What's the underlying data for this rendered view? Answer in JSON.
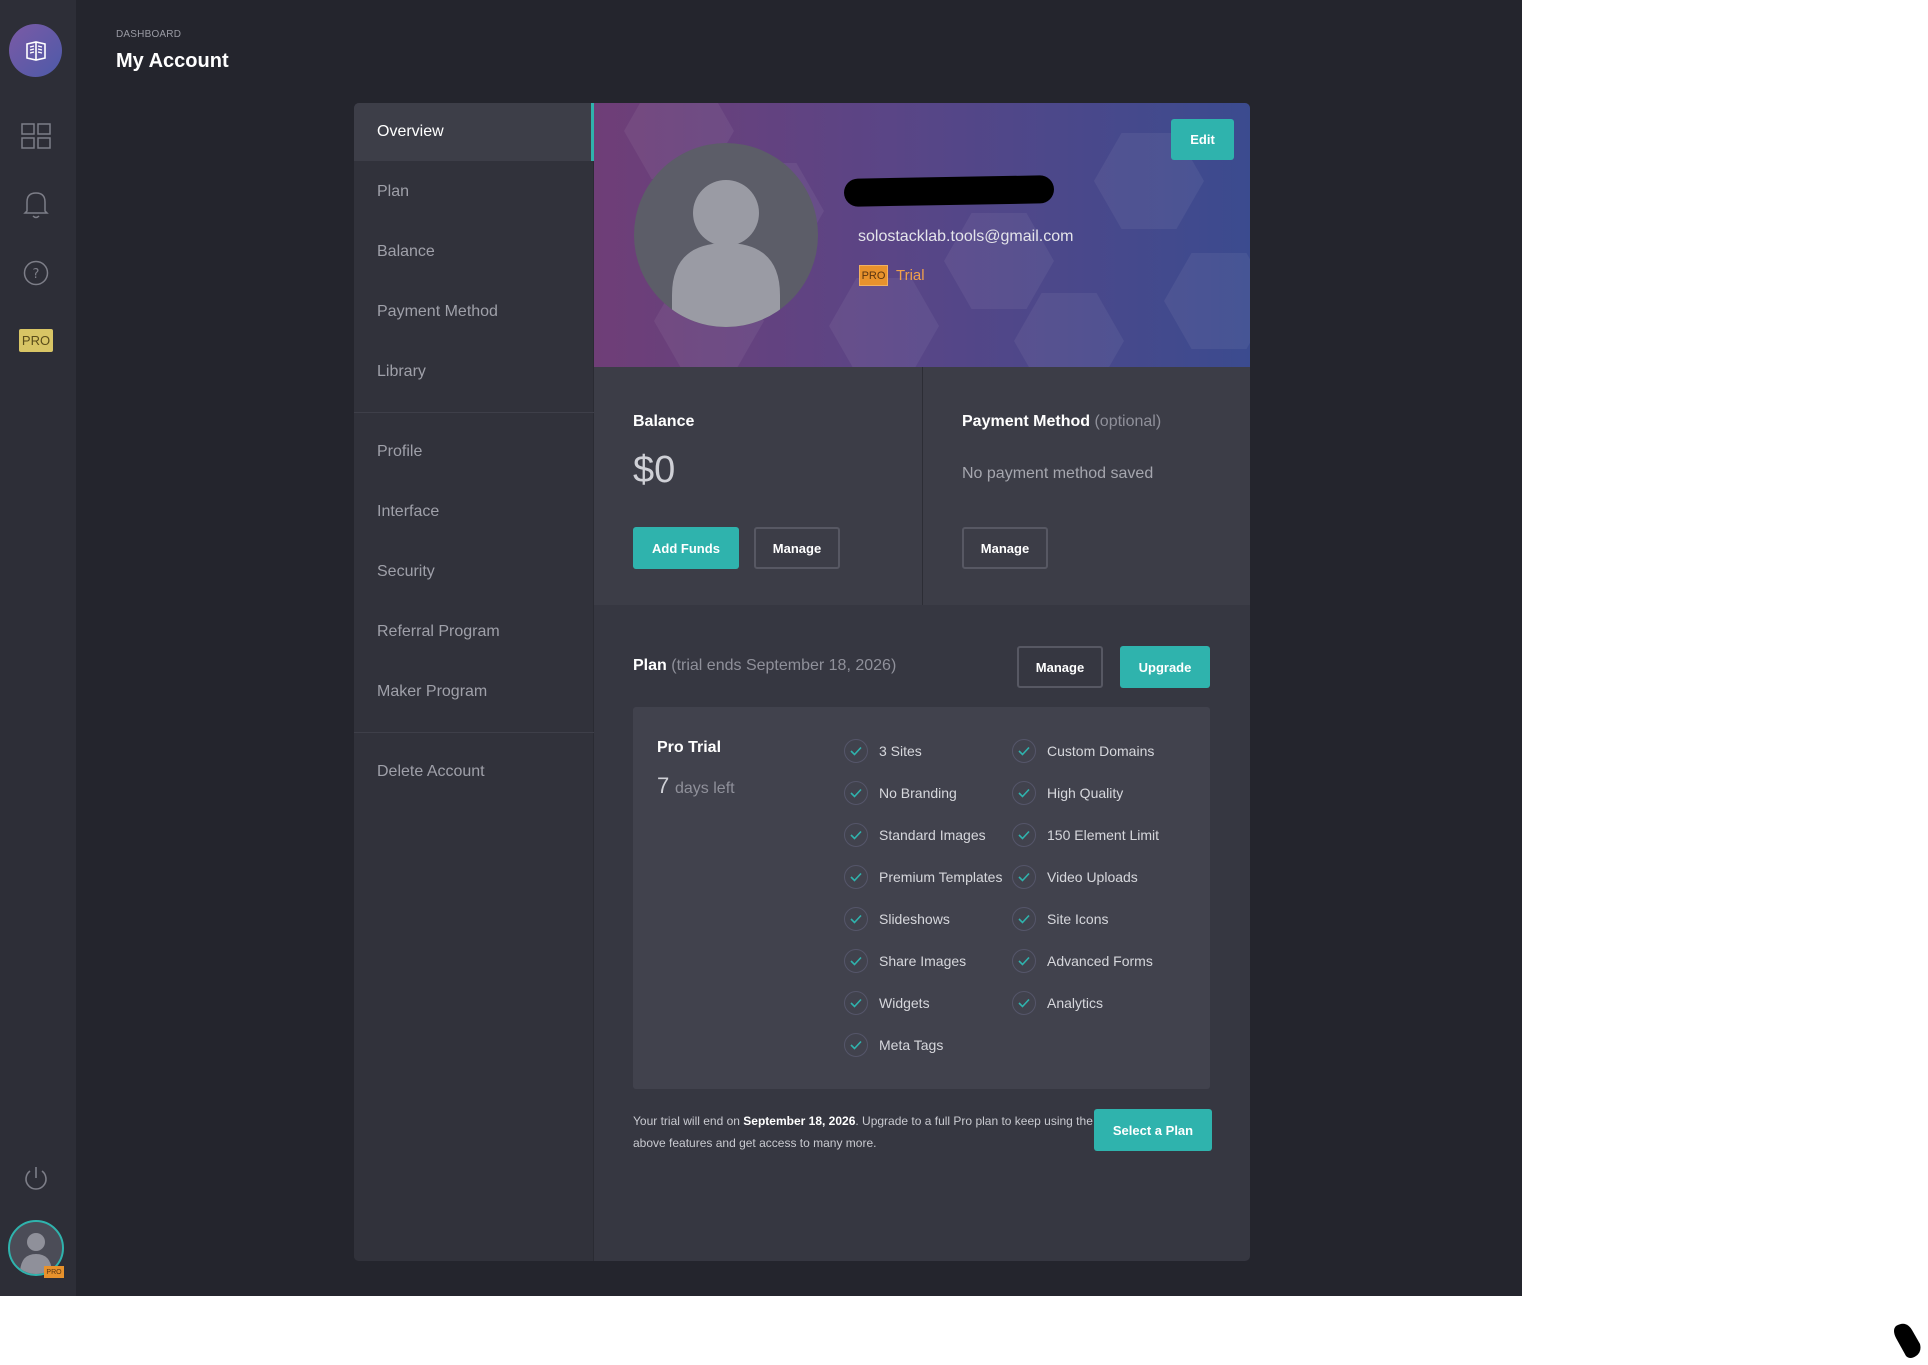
{
  "header": {
    "breadcrumb": "DASHBOARD",
    "title": "My Account"
  },
  "rail": {
    "pro_label": "PRO",
    "avatar_badge": "PRO"
  },
  "nav": {
    "items": [
      "Overview",
      "Plan",
      "Balance",
      "Payment Method",
      "Library",
      "Profile",
      "Interface",
      "Security",
      "Referral Program",
      "Maker Program",
      "Delete Account"
    ]
  },
  "profile": {
    "email": "solostacklab.tools@gmail.com",
    "pro_tag": "PRO",
    "trial_tag": "Trial",
    "edit_label": "Edit"
  },
  "balance": {
    "title": "Balance",
    "value": "$0",
    "add_funds_label": "Add Funds",
    "manage_label": "Manage"
  },
  "payment": {
    "title": "Payment Method",
    "optional": "(optional)",
    "empty": "No payment method saved",
    "manage_label": "Manage"
  },
  "plan": {
    "title": "Plan",
    "trial_note": "(trial ends September 18, 2026)",
    "manage_label": "Manage",
    "upgrade_label": "Upgrade",
    "name": "Pro Trial",
    "days": "7",
    "days_label": "days left",
    "features_left": [
      "3 Sites",
      "No Branding",
      "Standard Images",
      "Premium Templates",
      "Slideshows",
      "Share Images",
      "Widgets",
      "Meta Tags"
    ],
    "features_right": [
      "Custom Domains",
      "High Quality",
      "150 Element Limit",
      "Video Uploads",
      "Site Icons",
      "Advanced Forms",
      "Analytics"
    ],
    "footer_pre": "Your trial will end on ",
    "footer_date": "September 18, 2026",
    "footer_post": ". Upgrade to a full Pro plan to keep using the above features and get access to many more.",
    "select_label": "Select a Plan"
  },
  "colors": {
    "accent": "#2fb3ad",
    "pro": "#e8922c",
    "pro_rail": "#d8c565"
  }
}
